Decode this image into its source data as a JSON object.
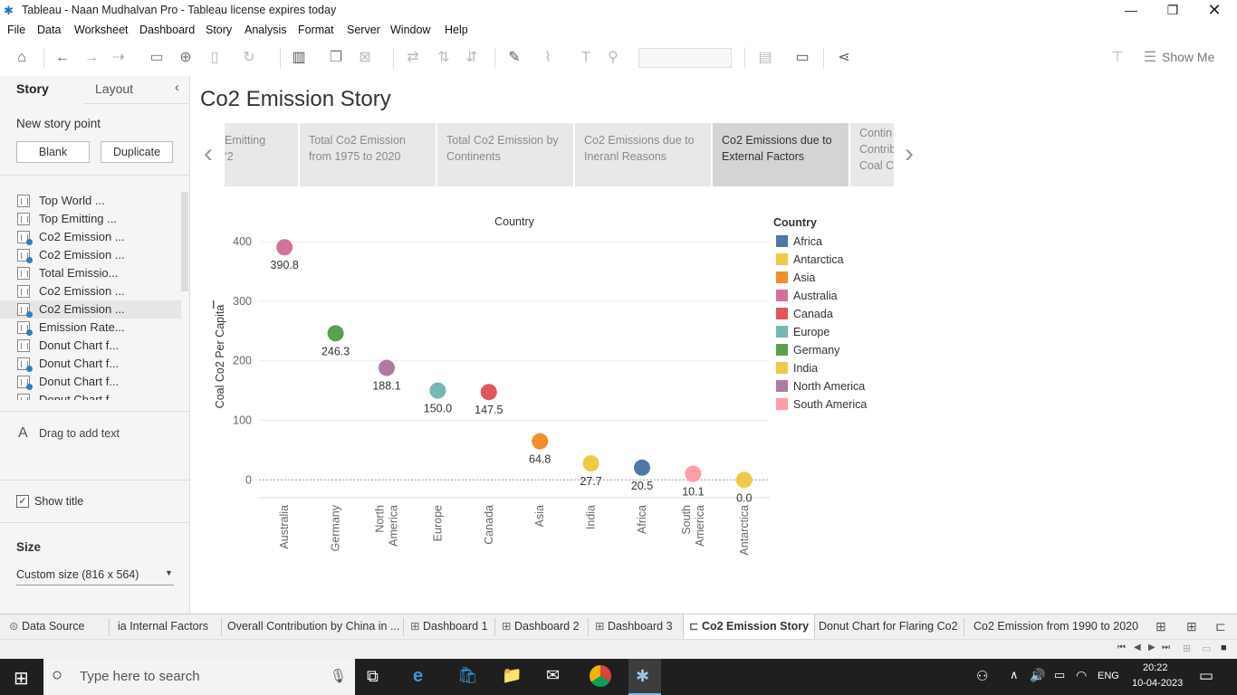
{
  "window": {
    "title": "Tableau - Naan Mudhalvan Pro - Tableau license expires today"
  },
  "menu": [
    "File",
    "Data",
    "Worksheet",
    "Dashboard",
    "Story",
    "Analysis",
    "Format",
    "Server",
    "Window",
    "Help"
  ],
  "toolbar": {
    "show_me": "Show Me"
  },
  "left_panel": {
    "tabs": {
      "story": "Story",
      "layout": "Layout"
    },
    "new_story_point": "New story point",
    "blank_button": "Blank",
    "duplicate_button": "Duplicate",
    "story_items": [
      {
        "label": "Top World ...",
        "checked": false
      },
      {
        "label": "Top Emitting ...",
        "checked": false
      },
      {
        "label": "Co2 Emission ...",
        "checked": true
      },
      {
        "label": "Co2 Emission ...",
        "checked": true
      },
      {
        "label": "Total Emissio...",
        "checked": false
      },
      {
        "label": "Co2 Emission ...",
        "checked": false
      },
      {
        "label": "Co2 Emission ...",
        "checked": true
      },
      {
        "label": "Emission Rate...",
        "checked": true
      },
      {
        "label": "Donut Chart f...",
        "checked": false
      },
      {
        "label": "Donut Chart f...",
        "checked": true
      },
      {
        "label": "Donut Chart f...",
        "checked": true
      },
      {
        "label": "Donut Chart f...",
        "checked": false
      }
    ],
    "drag_text": "Drag to add text",
    "show_title": "Show title",
    "size_heading": "Size",
    "size_value": "Custom size (816 x 564)"
  },
  "story": {
    "title": "Co2 Emission Story",
    "points": [
      {
        "line1": "Emitting",
        "line2": "‘2",
        "line3": ""
      },
      {
        "line1": "Total Co2 Emission",
        "line2": "from 1975 to 2020",
        "line3": ""
      },
      {
        "line1": "Total Co2  Emission by",
        "line2": "Continents",
        "line3": ""
      },
      {
        "line1": "Co2 Emissions due to",
        "line2": "Ineranl Reasons",
        "line3": ""
      },
      {
        "line1": "Co2 Emissions due to",
        "line2": "External Factors",
        "line3": ""
      },
      {
        "line1": "Contin",
        "line2": "Contrib",
        "line3": "Coal Co"
      }
    ]
  },
  "chart_data": {
    "type": "scatter",
    "title": "Country",
    "ylabel": "Coal Co2 Per Capita",
    "ylim": [
      -30,
      420
    ],
    "yticks": [
      0,
      100,
      200,
      300,
      400
    ],
    "categories": [
      "Australia",
      "Germany",
      "North America",
      "Europe",
      "Canada",
      "Asia",
      "India",
      "Africa",
      "South America",
      "Antarctica"
    ],
    "tick_labels": [
      [
        "Australia"
      ],
      [
        "Germany"
      ],
      [
        "North",
        "America"
      ],
      [
        "Europe"
      ],
      [
        "Canada"
      ],
      [
        "Asia"
      ],
      [
        "India"
      ],
      [
        "Africa"
      ],
      [
        "South",
        "America"
      ],
      [
        "Antarctica"
      ]
    ],
    "values": [
      390.8,
      246.3,
      188.1,
      150.0,
      147.5,
      64.8,
      27.7,
      20.5,
      10.1,
      0.0
    ],
    "value_labels": [
      "390.8",
      "246.3",
      "188.1",
      "150.0",
      "147.5",
      "64.8",
      "27.7",
      "20.5",
      "10.1",
      "0.0"
    ],
    "colors": [
      "#d4719a",
      "#59a14f",
      "#b07aa1",
      "#76b7b2",
      "#e15759",
      "#f28e2b",
      "#edc948",
      "#4e79a7",
      "#ff9da7",
      "#edc948"
    ],
    "legend_title": "Country",
    "legend": [
      {
        "name": "Africa",
        "color": "#4e79a7"
      },
      {
        "name": "Antarctica",
        "color": "#edc948"
      },
      {
        "name": "Asia",
        "color": "#f28e2b"
      },
      {
        "name": "Australia",
        "color": "#d4719a"
      },
      {
        "name": "Canada",
        "color": "#e15759"
      },
      {
        "name": "Europe",
        "color": "#76b7b2"
      },
      {
        "name": "Germany",
        "color": "#59a14f"
      },
      {
        "name": "India",
        "color": "#edc948"
      },
      {
        "name": "North America",
        "color": "#b07aa1"
      },
      {
        "name": "South America",
        "color": "#ff9da7"
      }
    ]
  },
  "sheet_tabs": {
    "data_source": "Data Source",
    "tabs": [
      "ia Internal Factors",
      "Overall Contribution by China in ...",
      "Dashboard 1",
      "Dashboard 2",
      "Dashboard 3",
      "Co2 Emission Story",
      "Donut Chart for Flaring Co2",
      "Co2 Emission from 1990 to 2020"
    ]
  },
  "taskbar": {
    "search_placeholder": "Type here to search",
    "lang": "ENG",
    "time": "20:22",
    "date": "10-04-2023"
  }
}
